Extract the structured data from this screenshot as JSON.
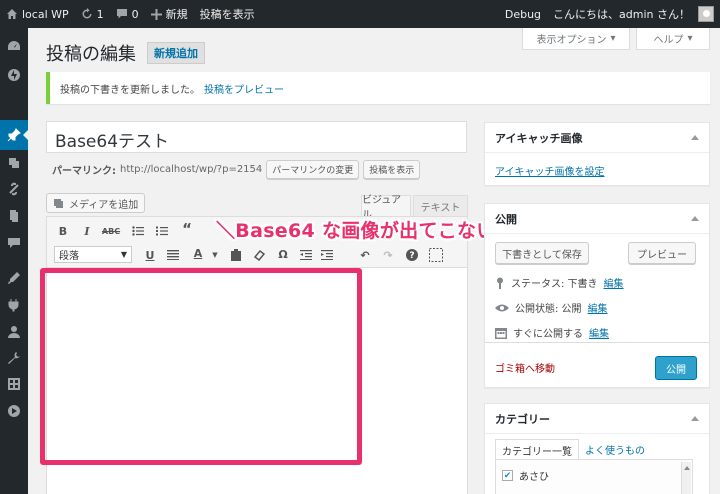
{
  "adminbar": {
    "site_name": "local WP",
    "updates_count": "1",
    "comments_count": "0",
    "new_label": "新規",
    "view_post": "投稿を表示",
    "debug": "Debug",
    "greeting": "こんにちは、admin さん！"
  },
  "screen": {
    "options": "表示オプション",
    "help": "ヘルプ"
  },
  "page": {
    "title": "投稿の編集",
    "add_new": "新規追加"
  },
  "notice": {
    "message": "投稿の下書きを更新しました。",
    "preview_link": "投稿をプレビュー"
  },
  "post": {
    "title": "Base64テスト",
    "permalink_label": "パーマリンク:",
    "permalink_url": "http://localhost/wp/?p=2154",
    "change_permalink": "パーマリンクの変更",
    "view_post": "投稿を表示"
  },
  "editor": {
    "add_media": "メディアを追加",
    "tab_visual": "ビジュアル",
    "tab_text": "テキスト",
    "format": "段落"
  },
  "annotation": "＼Base64 な画像が出てこない／",
  "featured": {
    "heading": "アイキャッチ画像",
    "set_link": "アイキャッチ画像を設定"
  },
  "publish": {
    "heading": "公開",
    "save_draft": "下書きとして保存",
    "preview": "プレビュー",
    "status_label": "ステータス: 下書き",
    "status_edit": "編集",
    "visibility_label": "公開状態: 公開",
    "visibility_edit": "編集",
    "schedule_label": "すぐに公開する",
    "schedule_edit": "編集",
    "trash": "ゴミ箱へ移動",
    "publish_btn": "公開"
  },
  "categories": {
    "heading": "カテゴリー",
    "tab_all": "カテゴリー一覧",
    "tab_popular": "よく使うもの",
    "items": [
      {
        "label": "あさひ",
        "checked": true
      }
    ]
  },
  "colors": {
    "adminbar_bg": "#23282d",
    "active_menu": "#0073aa",
    "highlight": "#e8316c",
    "notice_border": "#7ad03a"
  }
}
